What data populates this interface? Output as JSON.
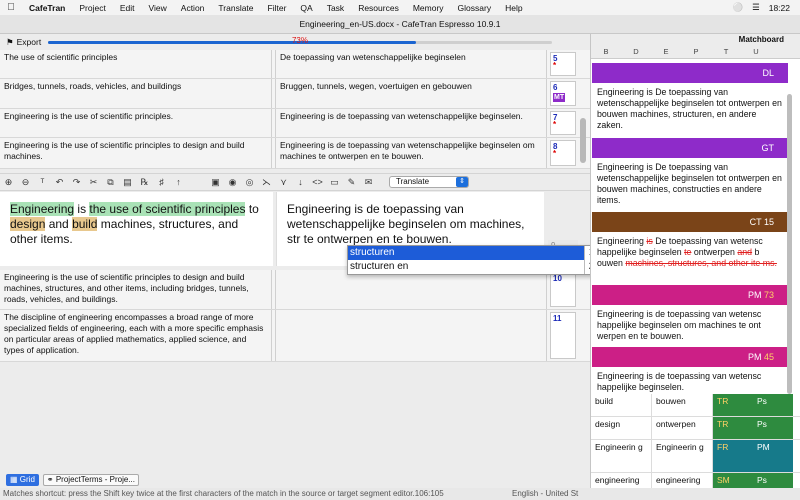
{
  "menubar": {
    "app": "CafeTran",
    "items": [
      "Project",
      "Edit",
      "View",
      "Action",
      "Translate",
      "Filter",
      "QA",
      "Task",
      "Resources",
      "Memory",
      "Glossary",
      "Help"
    ],
    "time": "18:22"
  },
  "window": {
    "title": "Engineering_en-US.docx - CafeTran Espresso 10.9.1"
  },
  "export": {
    "label": "Export",
    "progress_text": "73%",
    "progress": 0.73
  },
  "grid": {
    "rows": [
      {
        "source": "The use of scientific principles",
        "target": "De toepassing van wetenschappelijke beginselen",
        "num": "5",
        "mark": "*",
        "mt": ""
      },
      {
        "source": "Bridges, tunnels, roads, vehicles, and buildings",
        "target": "Bruggen, tunnels, wegen, voertuigen en gebouwen",
        "num": "6",
        "mark": "",
        "mt": "MT"
      },
      {
        "source": "Engineering is the use of scientific principles.",
        "target": "Engineering is de toepassing van wetenschappelijke beginselen.",
        "num": "7",
        "mark": "*",
        "mt": ""
      },
      {
        "source": "Engineering is the use of scientific principles to design and build machines.",
        "target": "Engineering is de toepassing van wetenschappelijke beginselen om machines te ontwerpen en te bouwen.",
        "num": "8",
        "mark": "*",
        "mt": ""
      }
    ],
    "rows_after": [
      {
        "source": "Engineering is the use of scientific principles to design and build machines, structures, and other items, including bridges, tunnels, roads, vehicles, and buildings.",
        "target": "",
        "num": "10"
      },
      {
        "source": "The discipline of engineering encompasses a broad range of more specialized fields of engineering, each with a more specific emphasis on particular areas of applied mathematics, applied science, and types of application.",
        "target": "",
        "num": "11"
      }
    ]
  },
  "toolbar": {
    "mode": "Translate"
  },
  "editor": {
    "source": {
      "w1": "Engineering",
      "t1": " is ",
      "w2": "the use of scientific principles",
      "t2": " to ",
      "w3": "design",
      "t3": " and ",
      "w4": "build",
      "t4": " machines, structures, and other items."
    },
    "target": "Engineering is de toepassing van wetenschappelijke beginselen om machines, str te ontwerpen en te bouwen.",
    "num": "9"
  },
  "autocomplete": [
    {
      "text": "structuren",
      "key": "1"
    },
    {
      "text": "structuren en",
      "key": "2"
    }
  ],
  "statusbar": {
    "tabs": [
      "Grid",
      "ProjectTerms - Proje..."
    ],
    "message": "Matches shortcut: press the Shift key twice at the first characters of the match in the source or target segment editor.106:105",
    "lang": "English - United St"
  },
  "matchboard": {
    "title": "Matchboard",
    "columns": [
      "B",
      "D",
      "E",
      "P",
      "T",
      "U"
    ],
    "matches": [
      {
        "label": "DL",
        "pct": "",
        "color": "#8e2bc9",
        "text": "Engineering is De toepassing van wetenschappelijke beginselen tot ontwerpen en bouwen machines, structuren, en andere zaken."
      },
      {
        "label": "GT",
        "pct": "",
        "color": "#8e2bc9",
        "text": "Engineering is De toepassing van wetenschappelijke beginselen tot ontwerpen en bouwen machines, constructies en andere items."
      },
      {
        "label": "CT",
        "pct": "15",
        "color": "#7a4418",
        "text": ""
      },
      {
        "label": "PM",
        "pct": "73",
        "color": "#cc1f86",
        "text": "Engineering is de toepassing van wetensc happelijke beginselen om machines te ont werpen en te bouwen."
      },
      {
        "label": "PM",
        "pct": "45",
        "color": "#cc1f86",
        "text": "Engineering is de toepassing van wetensc happelijke beginselen."
      }
    ],
    "ct_match": {
      "a": "Engineering ",
      "del1": "is",
      "b": " De toepassing van wetensc happelijke beginselen ",
      "del2": "te",
      "c": " ontwerpen ",
      "del3": "and",
      "d": " b ouwen ",
      "del4": "machines, structures, and other ite ms."
    },
    "terms": [
      {
        "src": "build",
        "tgt": "bouwen",
        "f1": "TR",
        "f2": "Ps",
        "c1": "#2e8b3f",
        "c2": "#2e8b3f"
      },
      {
        "src": "design",
        "tgt": "ontwerpen",
        "f1": "TR",
        "f2": "Ps",
        "c1": "#2e8b3f",
        "c2": "#2e8b3f"
      },
      {
        "src": "Engineerin g",
        "tgt": "Engineerin g",
        "f1": "FR",
        "f2": "PM",
        "c1": "#167a8a",
        "c2": "#167a8a"
      },
      {
        "src": "engineering",
        "tgt": "engineering",
        "f1": "SM",
        "f2": "Ps",
        "c1": "#2e8b3f",
        "c2": "#2e8b3f"
      },
      {
        "src": "principles",
        "tgt": "beginselen",
        "f1": "TR",
        "f2": "Ps",
        "c1": "#2e8b3f",
        "c2": "#2e8b3f"
      }
    ]
  }
}
